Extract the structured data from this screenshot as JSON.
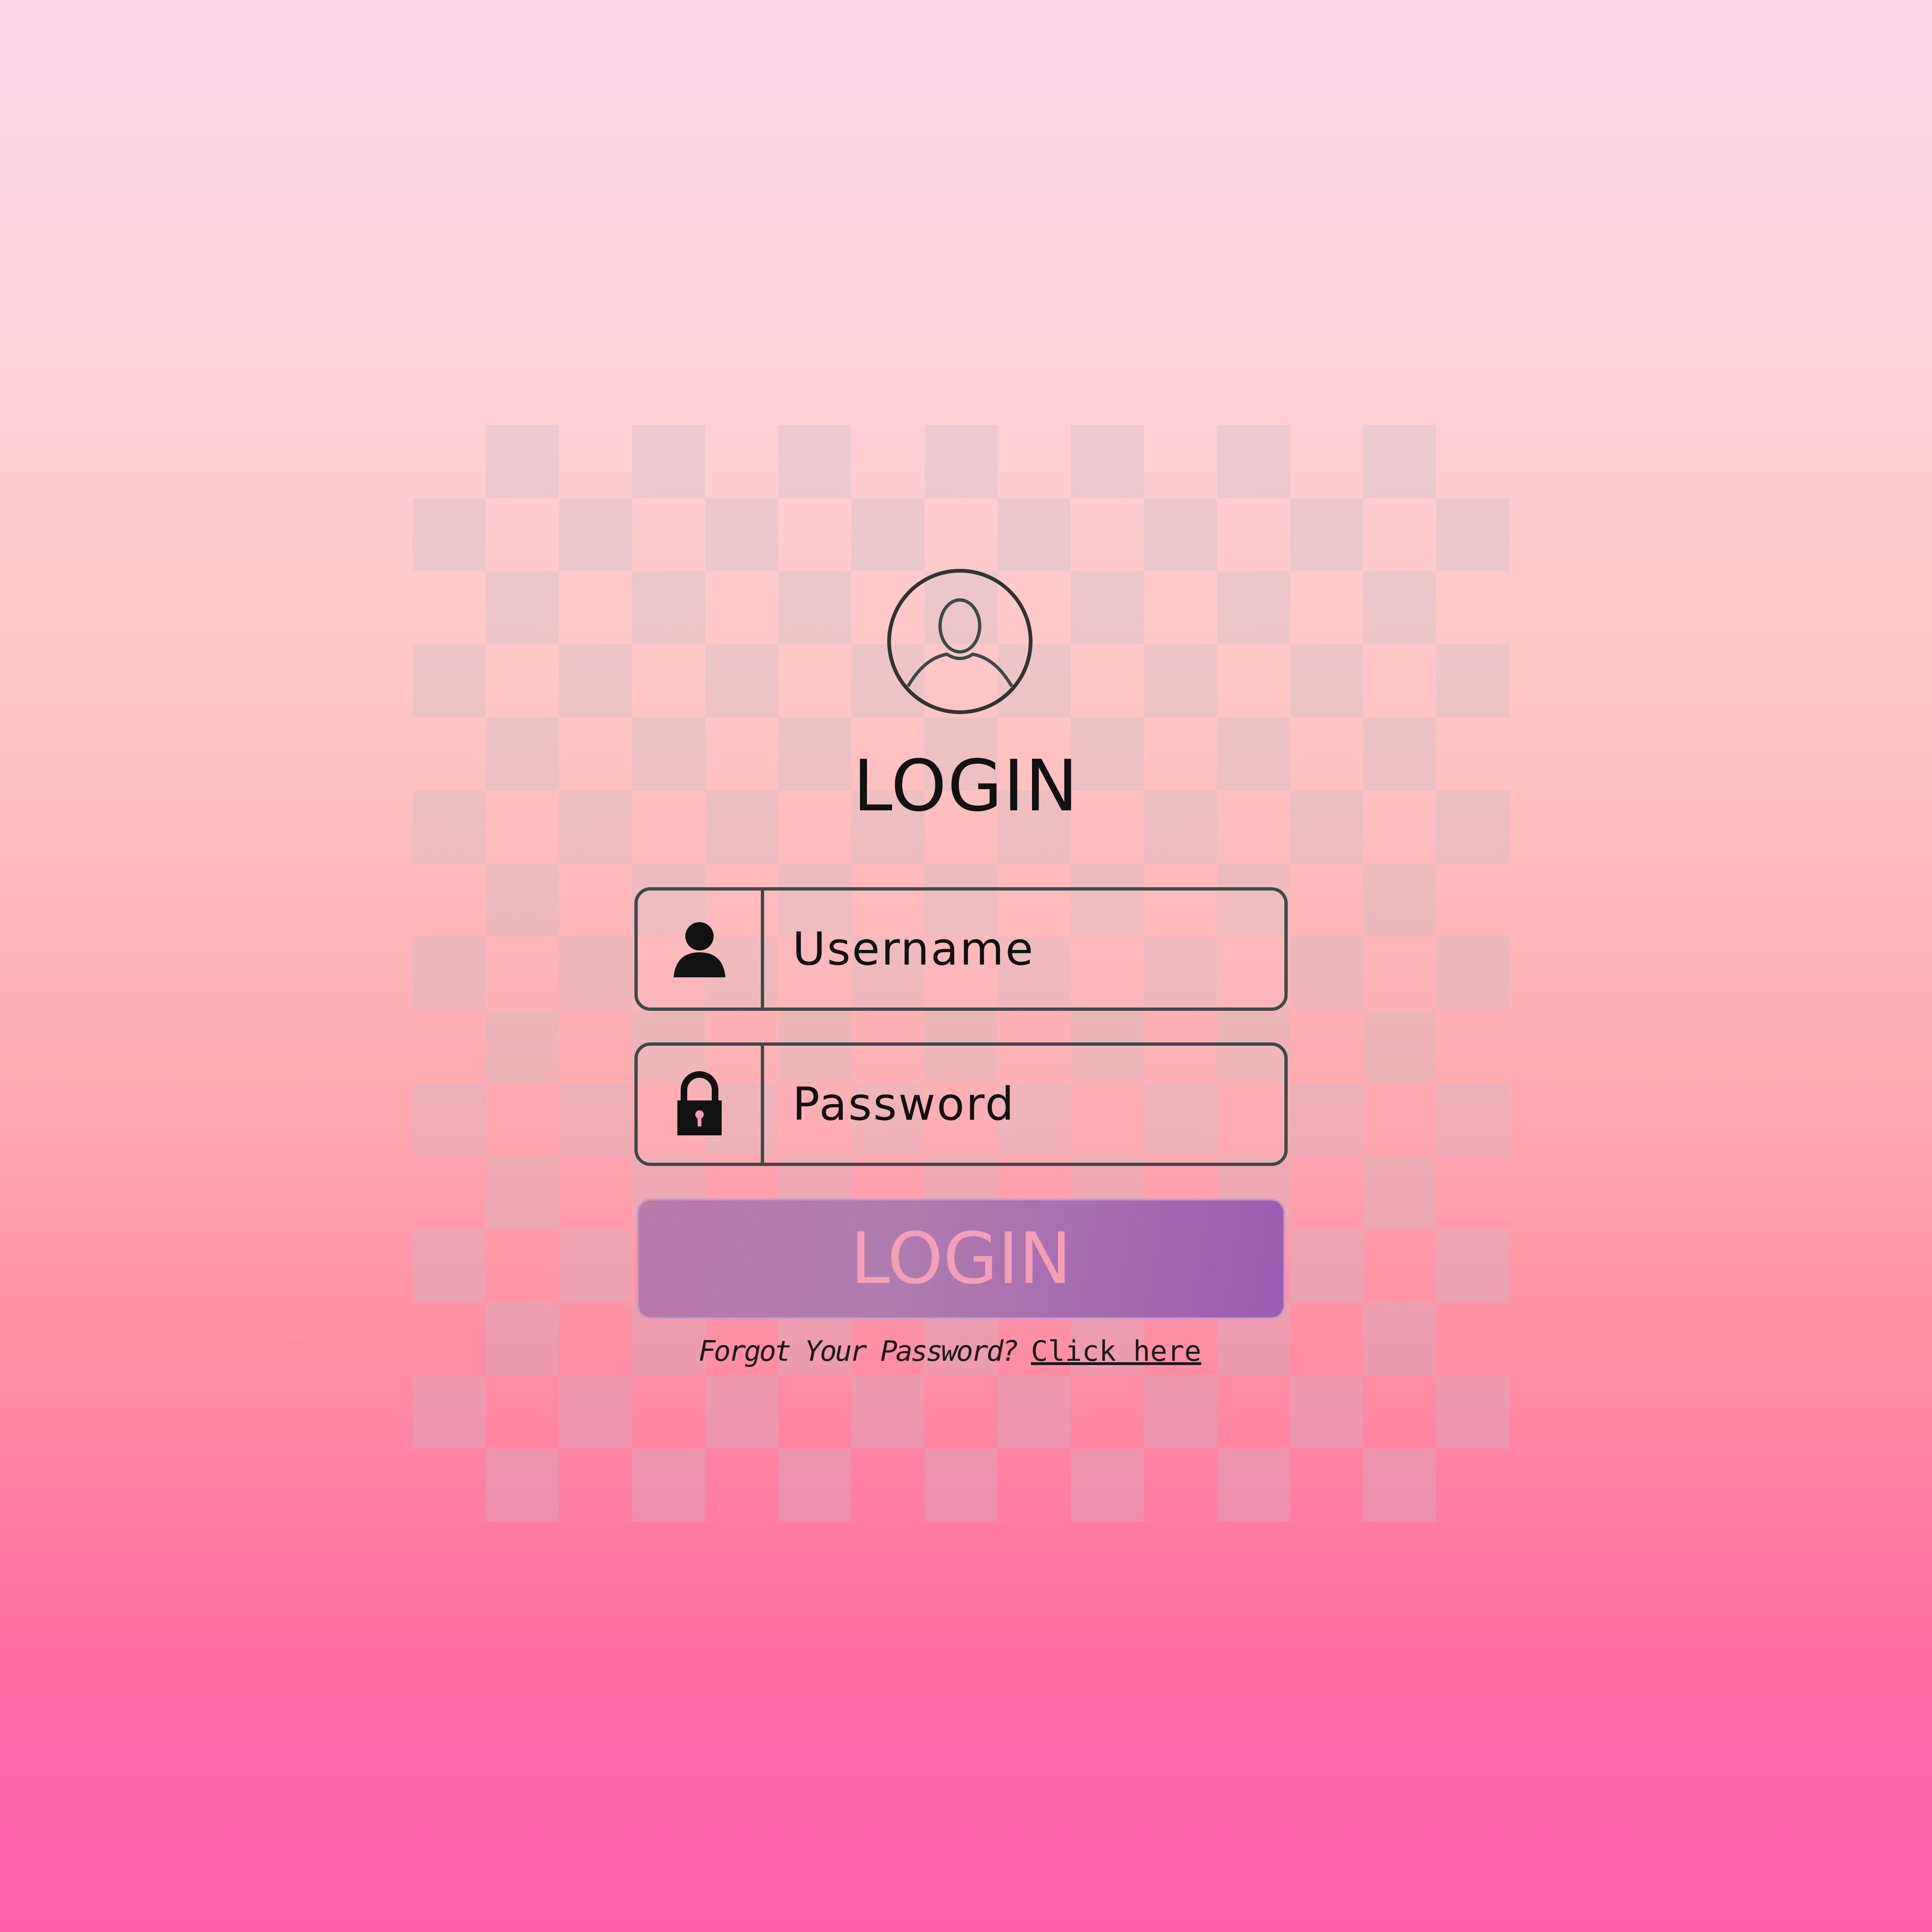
{
  "title": "LOGIN",
  "username": {
    "placeholder": "Username",
    "icon": "user-icon"
  },
  "password": {
    "placeholder": "Password",
    "icon": "lock-icon"
  },
  "login_button": "LOGIN",
  "forgot": {
    "text": "Forgot Your Password?",
    "link": "Click here"
  },
  "colors": {
    "button": "#a86cae",
    "border": "#3d4a4a"
  }
}
